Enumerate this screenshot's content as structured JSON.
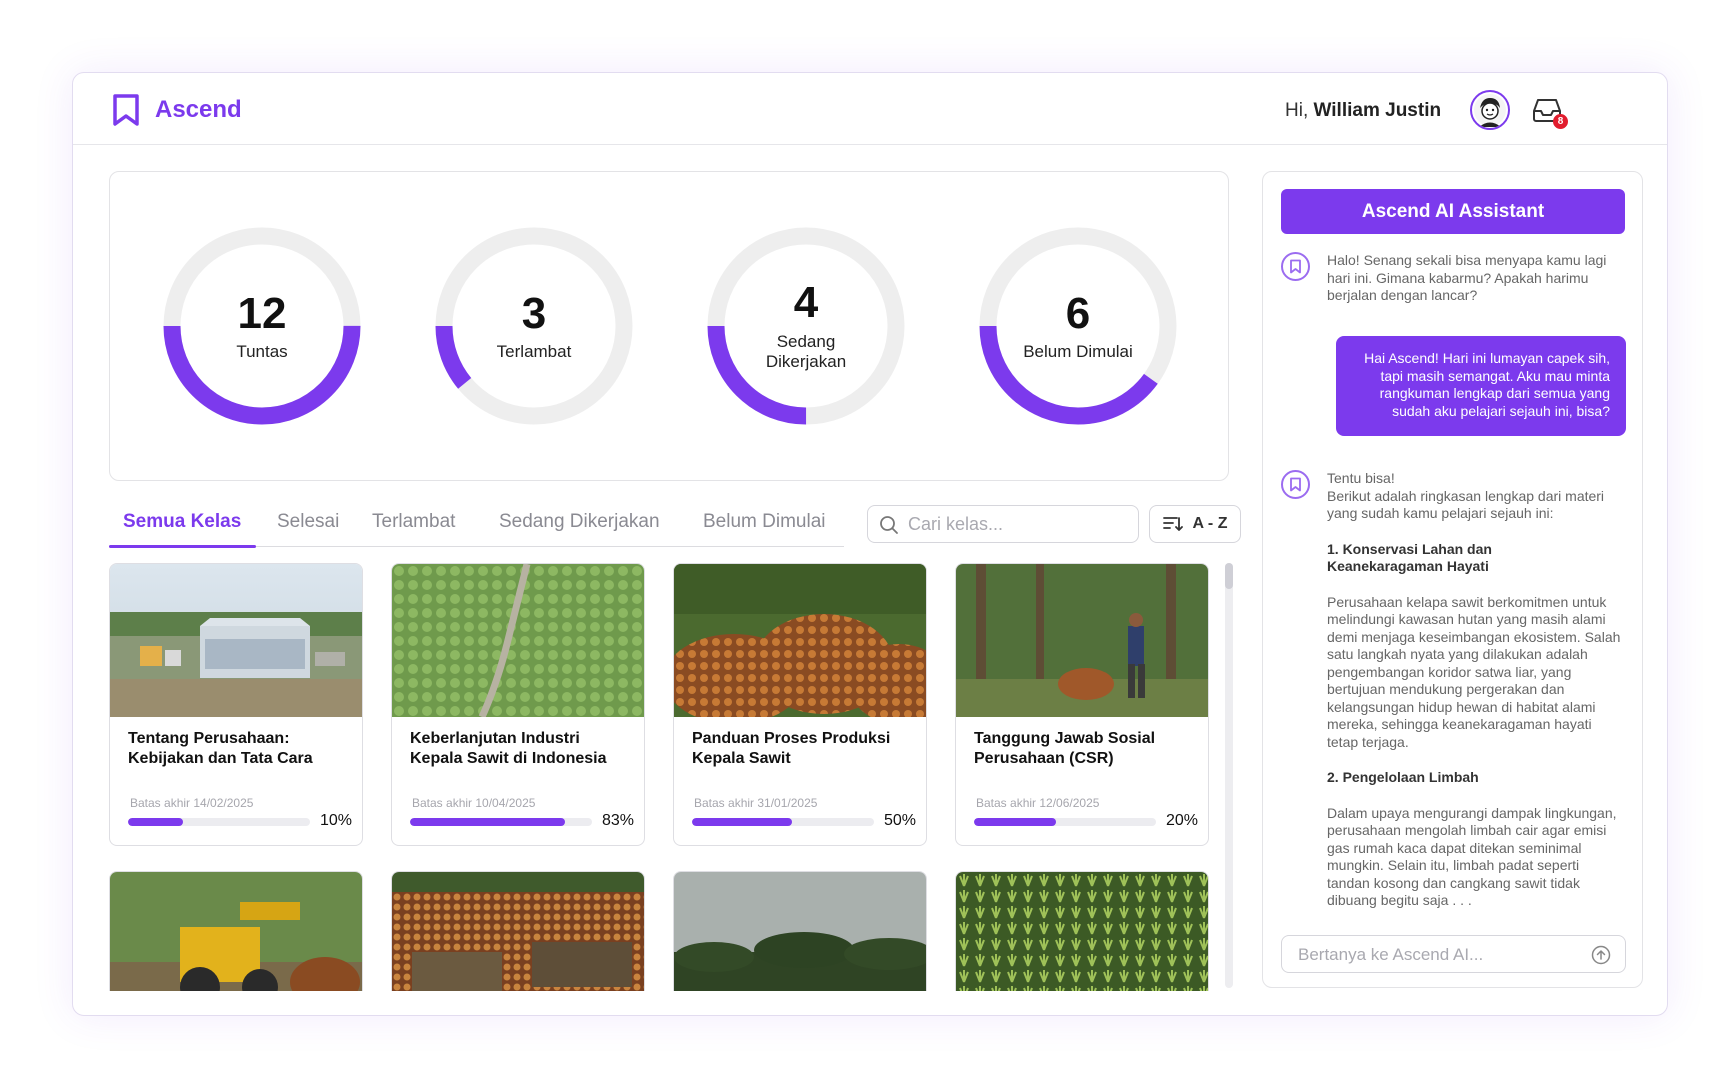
{
  "brand": {
    "name": "Ascend"
  },
  "user": {
    "greeting": "Hi,",
    "name": "William Justin",
    "notification_count": "8"
  },
  "colors": {
    "accent": "#7c3aed",
    "track": "#eeeeee",
    "badge": "#e11d2e"
  },
  "stats": [
    {
      "value": "12",
      "label": "Tuntas",
      "progress": 0.5,
      "icon": "ring-progress"
    },
    {
      "value": "3",
      "label": "Terlambat",
      "progress": 0.11
    },
    {
      "value": "4",
      "label": "Sedang Dikerjakan",
      "progress": 0.25
    },
    {
      "value": "6",
      "label": "Belum Dimulai",
      "progress": 0.4
    }
  ],
  "tabs": [
    {
      "label": "Semua Kelas",
      "active": true
    },
    {
      "label": "Selesai"
    },
    {
      "label": "Terlambat"
    },
    {
      "label": "Sedang Dikerjakan"
    },
    {
      "label": "Belum Dimulai"
    }
  ],
  "search": {
    "placeholder": "Cari kelas..."
  },
  "sort": {
    "label": "A - Z",
    "icon": "sort-icon"
  },
  "courses": [
    {
      "title": "Tentang Perusahaan: Kebijakan dan Tata Cara",
      "due": "Batas akhir 14/02/2025",
      "percent": "10%",
      "progress": 0.3,
      "image": "factory-photo"
    },
    {
      "title": "Keberlanjutan Industri Kepala Sawit di Indonesia",
      "due": "Batas akhir 10/04/2025",
      "percent": "83%",
      "progress": 0.85,
      "image": "plantation-road-photo"
    },
    {
      "title": "Panduan Proses Produksi Kepala Sawit",
      "due": "Batas akhir 31/01/2025",
      "percent": "50%",
      "progress": 0.55,
      "image": "palm-fruit-photo"
    },
    {
      "title": "Tanggung Jawab Sosial Perusahaan (CSR)",
      "due": "Batas akhir 12/06/2025",
      "percent": "20%",
      "progress": 0.45,
      "image": "worker-photo"
    },
    {
      "image": "loader-photo"
    },
    {
      "image": "trucks-photo"
    },
    {
      "image": "palm-skyline-photo"
    },
    {
      "image": "seedlings-photo"
    }
  ],
  "assistant": {
    "title": "Ascend AI Assistant",
    "bot_greeting": "Halo! Senang sekali bisa menyapa kamu lagi hari ini. Gimana kabarmu? Apakah harimu berjalan dengan lancar?",
    "user_message": "Hai Ascend! Hari ini lumayan capek sih, tapi masih semangat. Aku mau minta rangkuman lengkap dari semua yang sudah aku pelajari sejauh ini, bisa?",
    "bot_reply_intro": "Tentu bisa!",
    "bot_reply_lead": "Berikut adalah ringkasan lengkap dari materi yang sudah kamu pelajari sejauh ini:",
    "section1_title": "1. Konservasi Lahan dan\n    Keanekaragaman Hayati",
    "section1_body": "Perusahaan kelapa sawit berkomitmen untuk melindungi kawasan hutan yang masih alami demi menjaga keseimbangan ekosistem. Salah satu langkah nyata yang dilakukan adalah pengembangan koridor satwa liar, yang bertujuan mendukung pergerakan dan kelangsungan hidup hewan di habitat alami mereka, sehingga keanekaragaman hayati tetap terjaga.",
    "section2_title": "2. Pengelolaan Limbah",
    "section2_body": "Dalam upaya mengurangi dampak lingkungan, perusahaan mengolah limbah cair agar emisi gas rumah kaca dapat ditekan seminimal mungkin. Selain itu, limbah padat seperti tandan kosong dan cangkang sawit tidak dibuang begitu saja . . .",
    "input_placeholder": "Bertanya ke Ascend AI..."
  }
}
